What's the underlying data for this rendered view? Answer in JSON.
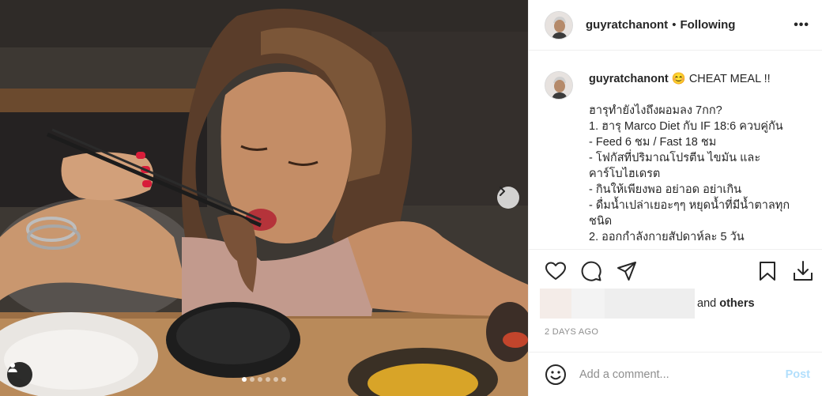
{
  "post": {
    "username": "guyratchanont",
    "separator": "•",
    "follow_status": "Following",
    "more_label": "•••"
  },
  "caption": {
    "username": "guyratchanont",
    "first_line": "😊 CHEAT MEAL !!",
    "lines": [
      "ฮารุทำยังไงถึงผอมลง 7กก?",
      "1. ฮารุ Marco Diet กับ IF 18:6 ควบคู่กัน",
      "- Feed 6 ชม / Fast 18 ชม",
      "- โฟกัสที่ปริมาณโปรตีน ไขมัน และ",
      "คาร์โบไฮเดรต",
      "- กินให้เพียงพอ อย่าอด อย่าเกิน",
      "- ดื่มน้ำเปล่าเยอะๆๆ หยุดน้ำที่มีน้ำตาลทุก",
      "ชนิด",
      "2. ออกกำลังกายสัปดาห์ละ 5 วัน"
    ]
  },
  "likes": {
    "and_text": "and",
    "others_text": "others"
  },
  "timestamp": "2 DAYS AGO",
  "comment": {
    "placeholder": "Add a comment...",
    "post_label": "Post"
  },
  "carousel": {
    "dot_count": 6,
    "active_index": 0
  },
  "colors": {
    "text": "#262626",
    "muted": "#8e8e8e",
    "border": "#efefef",
    "post_disabled": "#b2dffc"
  },
  "icons": [
    "heart-icon",
    "comment-icon",
    "share-icon",
    "bookmark-icon",
    "download-icon",
    "emoji-icon",
    "user-tag-icon",
    "chevron-right-icon",
    "more-icon"
  ]
}
